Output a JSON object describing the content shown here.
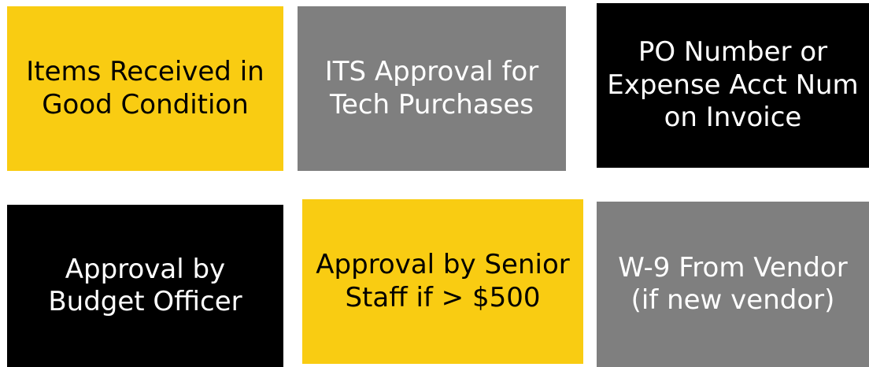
{
  "tiles": [
    {
      "lines": [
        "Items Received in",
        "Good Condition"
      ],
      "color": "#f9cc12"
    },
    {
      "lines": [
        "ITS Approval for",
        "Tech Purchases"
      ],
      "color": "#7f7f7f"
    },
    {
      "lines": [
        "PO Number or",
        "Expense Acct Num",
        "on Invoice"
      ],
      "color": "#000000"
    },
    {
      "lines": [
        "Approval by",
        "Budget Officer"
      ],
      "color": "#000000"
    },
    {
      "lines": [
        "Approval by Senior",
        "Staff if > $500"
      ],
      "color": "#f9cc12"
    },
    {
      "lines": [
        "W-9 From Vendor",
        "(if new vendor)"
      ],
      "color": "#7f7f7f"
    }
  ]
}
